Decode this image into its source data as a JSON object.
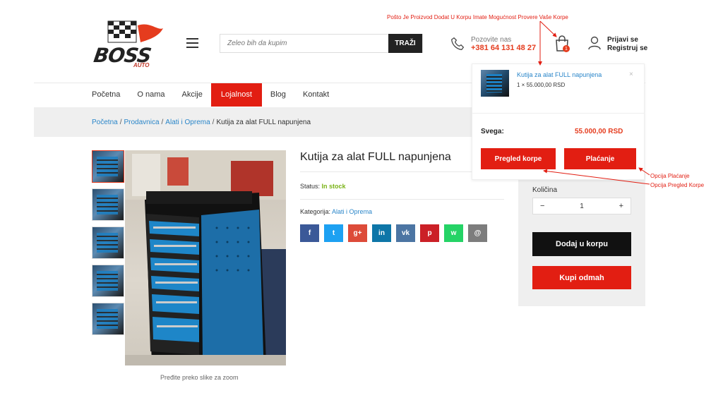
{
  "header": {
    "logo_text": "BOSS",
    "logo_sub": "AUTO",
    "search_placeholder": "Želeo bih da kupim",
    "search_button": "TRAŽI",
    "phone_label": "Pozovite nas",
    "phone_number": "+381 64 131 48 27",
    "cart_count": "1",
    "login_line1": "Prijavi se",
    "login_line2": "Registruj se"
  },
  "nav": {
    "items": [
      "Početna",
      "O nama",
      "Akcije",
      "Lojalnost",
      "Blog",
      "Kontakt"
    ],
    "active": "Lojalnost"
  },
  "breadcrumb": {
    "items": [
      "Početna",
      "Prodavnica",
      "Alati i Oprema"
    ],
    "current": "Kutija za alat FULL napunjena"
  },
  "product": {
    "title": "Kutija za alat FULL napunjena",
    "status_label": "Status:",
    "status_value": "In stock",
    "category_label": "Kategorija:",
    "category_value": "Alati i Oprema",
    "zoom_caption": "Pređite preko slike za zoom",
    "share_icons": [
      "facebook-icon",
      "twitter-icon",
      "google-plus-icon",
      "linkedin-icon",
      "vk-icon",
      "pinterest-icon",
      "whatsapp-icon",
      "email-icon"
    ],
    "share_colors": [
      "#3b5998",
      "#1da1f2",
      "#dd4b39",
      "#0e76a8",
      "#4c75a3",
      "#cb2027",
      "#25d366",
      "#7d7d7d"
    ],
    "share_glyphs": [
      "f",
      "t",
      "g+",
      "in",
      "vk",
      "p",
      "w",
      "@"
    ]
  },
  "buybox": {
    "qty_label": "Količina",
    "qty_minus": "−",
    "qty_value": "1",
    "qty_plus": "+",
    "add_to_cart": "Dodaj u korpu",
    "buy_now": "Kupi odmah"
  },
  "cart_dropdown": {
    "item_name": "Kutija za alat FULL napunjena",
    "item_qty": "1 × 55.000,00 RSD",
    "close": "×",
    "total_label": "Svega:",
    "total_value": "55.000,00 RSD",
    "view_cart": "Pregled korpe",
    "checkout": "Plaćanje"
  },
  "annotations": {
    "top": "Pošto Je Proizvod Dodat U Korpu Imate Mogućnost Provere Vaše Korpe",
    "payment": "Opcija Plaćanje",
    "view_cart": "Opcija Pregled Korpe",
    "color": "#e21e12"
  }
}
